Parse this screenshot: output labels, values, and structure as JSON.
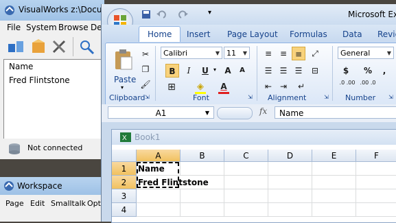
{
  "visualworks": {
    "title": "VisualWorks z:\\Documents",
    "menu": [
      "File",
      "System",
      "Browse",
      "Debug"
    ],
    "list": [
      "Name",
      "Fred Flintstone"
    ],
    "status": "Not connected"
  },
  "workspace": {
    "title": "Workspace",
    "menu": [
      "Page",
      "Edit",
      "Smalltalk",
      "Options"
    ]
  },
  "excel": {
    "title": "Microsoft Excel",
    "tabs": [
      "Home",
      "Insert",
      "Page Layout",
      "Formulas",
      "Data",
      "Review"
    ],
    "active_tab": "Home",
    "font_name": "Calibri",
    "font_size": "11",
    "number_format": "General",
    "groups": [
      "Clipboard",
      "Font",
      "Alignment",
      "Number"
    ],
    "paste_label": "Paste",
    "name_box": "A1",
    "fx": "fx",
    "formula_value": "Name",
    "workbook_title": "Book1",
    "columns": [
      "A",
      "B",
      "C",
      "D",
      "E",
      "F"
    ],
    "rows": [
      "1",
      "2",
      "3",
      "4"
    ],
    "cells": {
      "A1": "Name",
      "A2": "Fred Flintstone"
    },
    "number_buttons": {
      "currency": "$",
      "percent": "%",
      "comma": ",",
      "inc_decimal": ".0 .00",
      "dec_decimal": ".00 .0"
    },
    "font_buttons": {
      "bold": "B",
      "italic": "I",
      "underline": "U",
      "grow": "A",
      "shrink": "A"
    }
  }
}
